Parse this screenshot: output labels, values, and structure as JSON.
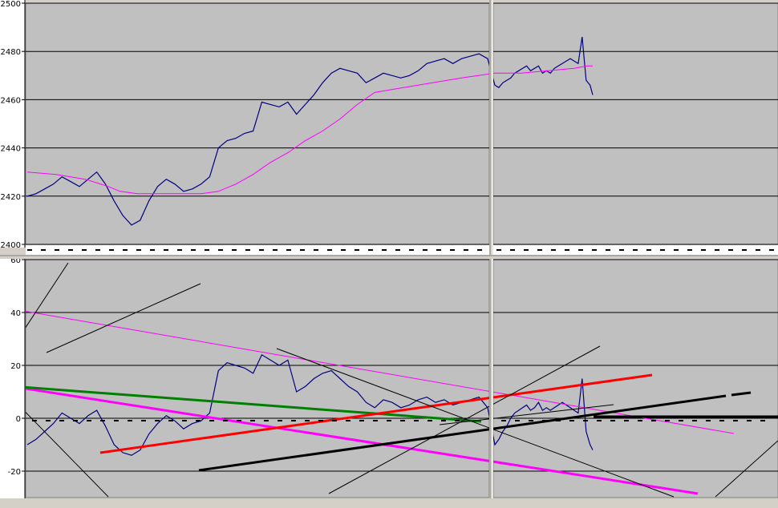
{
  "chart_data": [
    {
      "type": "line",
      "panel": "upper",
      "title": "",
      "xlabel": "",
      "ylabel": "",
      "ylim": [
        2400,
        2500
      ],
      "yticks": [
        "2500",
        "2480",
        "2460",
        "2440",
        "2420",
        "2400"
      ],
      "grid": true,
      "background": "#c0c0c0",
      "series": [
        {
          "color": "#000080",
          "points": [
            [
              0,
              2420
            ],
            [
              3,
              2421
            ],
            [
              6,
              2423
            ],
            [
              9,
              2425
            ],
            [
              12,
              2428
            ],
            [
              15,
              2426
            ],
            [
              18,
              2424
            ],
            [
              21,
              2427
            ],
            [
              24,
              2430
            ],
            [
              27,
              2425
            ],
            [
              30,
              2418
            ],
            [
              33,
              2412
            ],
            [
              36,
              2408
            ],
            [
              39,
              2410
            ],
            [
              42,
              2418
            ],
            [
              45,
              2424
            ],
            [
              48,
              2427
            ],
            [
              51,
              2425
            ],
            [
              54,
              2422
            ],
            [
              57,
              2423
            ],
            [
              60,
              2425
            ],
            [
              63,
              2428
            ],
            [
              66,
              2440
            ],
            [
              69,
              2443
            ],
            [
              72,
              2444
            ],
            [
              75,
              2446
            ],
            [
              78,
              2447
            ],
            [
              81,
              2459
            ],
            [
              84,
              2458
            ],
            [
              87,
              2457
            ],
            [
              90,
              2459
            ],
            [
              93,
              2454
            ],
            [
              96,
              2458
            ],
            [
              99,
              2462
            ],
            [
              102,
              2467
            ],
            [
              105,
              2471
            ],
            [
              108,
              2473
            ],
            [
              111,
              2472
            ],
            [
              114,
              2471
            ],
            [
              117,
              2467
            ],
            [
              120,
              2469
            ],
            [
              123,
              2471
            ],
            [
              126,
              2470
            ],
            [
              129,
              2469
            ],
            [
              132,
              2470
            ],
            [
              135,
              2472
            ],
            [
              138,
              2475
            ],
            [
              141,
              2476
            ],
            [
              144,
              2477
            ],
            [
              147,
              2475
            ],
            [
              150,
              2477
            ],
            [
              153,
              2478
            ],
            [
              156,
              2479
            ],
            [
              159,
              2477
            ],
            [
              160,
              2466
            ],
            [
              163,
              2465
            ],
            [
              166,
              2467
            ],
            [
              169,
              2468
            ],
            [
              172,
              2469
            ],
            [
              175,
              2471
            ],
            [
              178,
              2472
            ],
            [
              181,
              2473
            ],
            [
              184,
              2474
            ],
            [
              187,
              2472
            ],
            [
              190,
              2473
            ],
            [
              193,
              2474
            ],
            [
              196,
              2471
            ],
            [
              199,
              2472
            ],
            [
              202,
              2471
            ],
            [
              205,
              2473
            ],
            [
              208,
              2474
            ],
            [
              211,
              2475
            ],
            [
              214,
              2476
            ],
            [
              217,
              2477
            ],
            [
              220,
              2476
            ],
            [
              223,
              2475
            ],
            [
              226,
              2486
            ],
            [
              229,
              2468
            ],
            [
              232,
              2466
            ],
            [
              234,
              2462
            ]
          ]
        },
        {
          "color": "#ff00ff",
          "points": [
            [
              0,
              2430
            ],
            [
              10,
              2429
            ],
            [
              20,
              2427
            ],
            [
              28,
              2424
            ],
            [
              32,
              2422
            ],
            [
              38,
              2421
            ],
            [
              50,
              2421
            ],
            [
              60,
              2421
            ],
            [
              66,
              2422
            ],
            [
              72,
              2425
            ],
            [
              78,
              2429
            ],
            [
              84,
              2434
            ],
            [
              90,
              2438
            ],
            [
              96,
              2443
            ],
            [
              102,
              2447
            ],
            [
              108,
              2452
            ],
            [
              114,
              2458
            ],
            [
              120,
              2463
            ],
            [
              130,
              2465
            ],
            [
              140,
              2467
            ],
            [
              150,
              2469
            ],
            [
              160,
              2471
            ],
            [
              180,
              2471
            ],
            [
              200,
              2472
            ],
            [
              220,
              2473
            ],
            [
              230,
              2474
            ],
            [
              234,
              2474
            ]
          ]
        }
      ]
    },
    {
      "type": "line",
      "panel": "lower",
      "title": "",
      "xlabel": "",
      "ylabel": "",
      "ylim": [
        -30,
        60
      ],
      "yticks": [
        "60",
        "40",
        "20",
        "0",
        "-20"
      ],
      "grid": true,
      "background": "#c0c0c0",
      "series": [
        {
          "color": "#000080",
          "points": [
            [
              0,
              -10
            ],
            [
              3,
              -8
            ],
            [
              6,
              -5
            ],
            [
              9,
              -2
            ],
            [
              12,
              2
            ],
            [
              15,
              0
            ],
            [
              18,
              -2
            ],
            [
              21,
              1
            ],
            [
              24,
              3
            ],
            [
              27,
              -3
            ],
            [
              30,
              -10
            ],
            [
              33,
              -13
            ],
            [
              36,
              -14
            ],
            [
              39,
              -12
            ],
            [
              42,
              -6
            ],
            [
              45,
              -2
            ],
            [
              48,
              1
            ],
            [
              51,
              -1
            ],
            [
              54,
              -4
            ],
            [
              57,
              -2
            ],
            [
              60,
              -1
            ],
            [
              63,
              2
            ],
            [
              66,
              18
            ],
            [
              69,
              21
            ],
            [
              72,
              20
            ],
            [
              75,
              19
            ],
            [
              78,
              17
            ],
            [
              81,
              24
            ],
            [
              84,
              22
            ],
            [
              87,
              20
            ],
            [
              90,
              22
            ],
            [
              93,
              10
            ],
            [
              96,
              12
            ],
            [
              99,
              15
            ],
            [
              102,
              17
            ],
            [
              105,
              18
            ],
            [
              108,
              15
            ],
            [
              111,
              12
            ],
            [
              114,
              10
            ],
            [
              117,
              6
            ],
            [
              120,
              4
            ],
            [
              123,
              7
            ],
            [
              126,
              6
            ],
            [
              129,
              4
            ],
            [
              132,
              5
            ],
            [
              135,
              7
            ],
            [
              138,
              8
            ],
            [
              141,
              6
            ],
            [
              144,
              7
            ],
            [
              147,
              5
            ],
            [
              150,
              6
            ],
            [
              153,
              7
            ],
            [
              156,
              8
            ],
            [
              159,
              4
            ],
            [
              160,
              -10
            ],
            [
              163,
              -8
            ],
            [
              166,
              -5
            ],
            [
              169,
              -3
            ],
            [
              172,
              0
            ],
            [
              175,
              2
            ],
            [
              178,
              3
            ],
            [
              181,
              4
            ],
            [
              184,
              5
            ],
            [
              187,
              3
            ],
            [
              190,
              4
            ],
            [
              193,
              6
            ],
            [
              196,
              3
            ],
            [
              199,
              4
            ],
            [
              202,
              3
            ],
            [
              205,
              4
            ],
            [
              208,
              5
            ],
            [
              211,
              6
            ],
            [
              214,
              5
            ],
            [
              217,
              4
            ],
            [
              220,
              3
            ],
            [
              223,
              2
            ],
            [
              226,
              15
            ],
            [
              229,
              -5
            ],
            [
              232,
              -10
            ],
            [
              234,
              -12
            ]
          ]
        }
      ]
    }
  ]
}
